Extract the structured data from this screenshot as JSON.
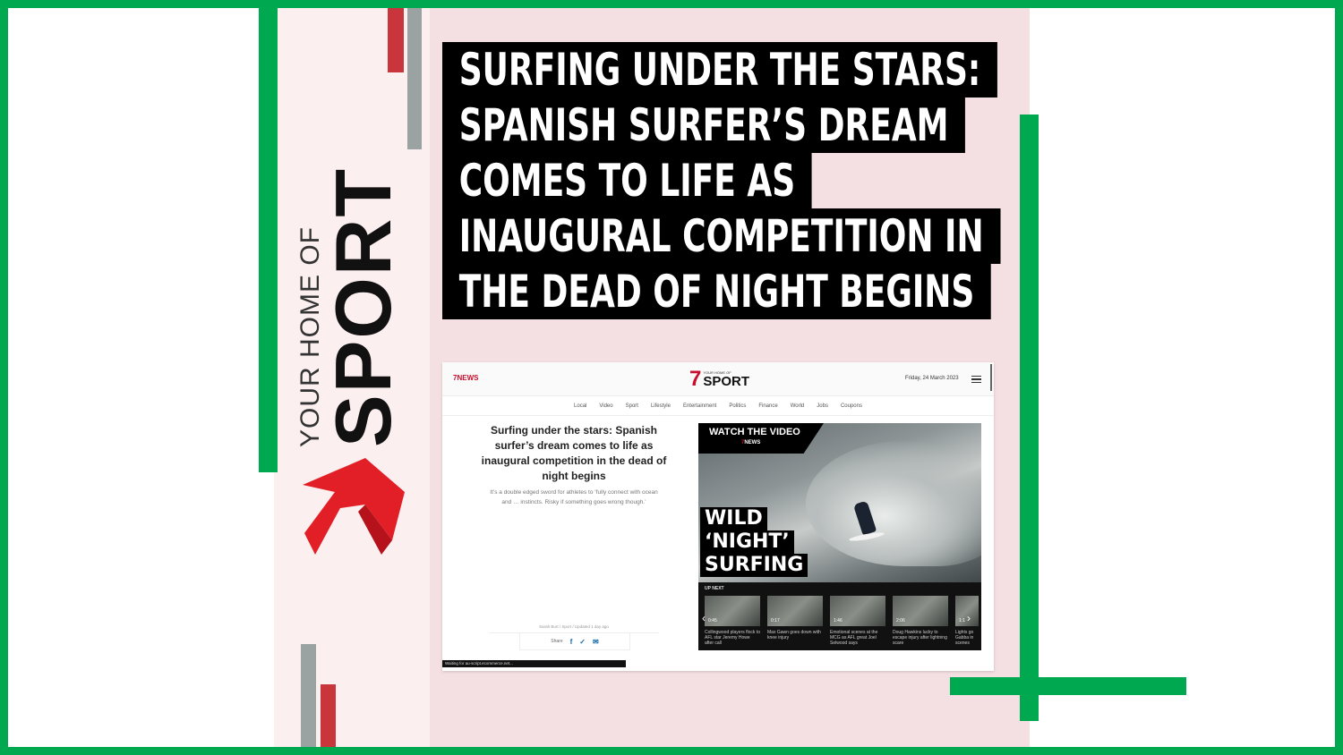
{
  "brand": {
    "small_text": "YOUR HOME OF",
    "big_text": "SPORT",
    "logo_icon": "seven-network-logo-icon"
  },
  "headline": {
    "lines": [
      "SURFING UNDER THE STARS:",
      "SPANISH SURFER’S DREAM",
      "COMES TO LIFE AS",
      "INAUGURAL COMPETITION IN",
      "THE DEAD OF NIGHT BEGINS"
    ]
  },
  "colors": {
    "frame_green": "#00a94f",
    "brand_red": "#c8102e",
    "deco_grey": "#9aa3a2"
  },
  "site": {
    "news_logo": "7NEWS",
    "sport_logo_prefix": "7",
    "sport_logo_tagline": "YOUR HOME OF",
    "sport_logo_name": "SPORT",
    "date": "Friday, 24 March 2023",
    "nav": [
      "Local",
      "Video",
      "Sport",
      "Lifestyle",
      "Entertainment",
      "Politics",
      "Finance",
      "World",
      "Jobs",
      "Coupons"
    ],
    "article_title": "Surfing under the stars: Spanish surfer’s dream comes to life as inaugural competition in the dead of night begins",
    "article_sub": "It’s a double edged sword for athletes to ‘fully connect with ocean and … instincts. Risky if something goes wrong though.’",
    "byline": "Sarah Burt / Sport / Updated 1 day ago",
    "share_label": "Share",
    "status": "Waiting for au-script.ecommerce.net..."
  },
  "video": {
    "watch_label": "WATCH THE VIDEO",
    "watch_logo_prefix": "7",
    "watch_logo_name": "NEWS",
    "wild_lines": [
      "WILD",
      "‘NIGHT’",
      "SURFING"
    ],
    "up_next_label": "UP NEXT",
    "thumbs": [
      {
        "duration": "0:45",
        "caption": "Collingwood players flock to AFL star Jeremy Howe after call"
      },
      {
        "duration": "0:17",
        "caption": "Max Gawn goes down with knee injury"
      },
      {
        "duration": "1:46",
        "caption": "Emotional scenes at the MCG as AFL great Joel Selwood says"
      },
      {
        "duration": "2:06",
        "caption": "Doug Hawkins lucky to escape injury after lightning scare"
      },
      {
        "duration": "1:1",
        "caption": "Lights go Gabba in scenes"
      }
    ]
  }
}
